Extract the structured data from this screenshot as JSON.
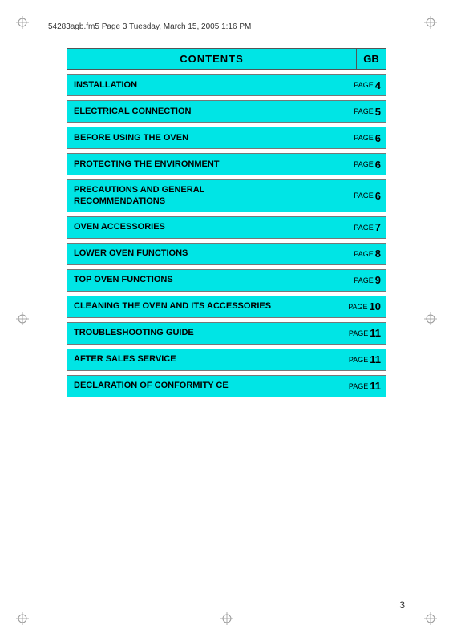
{
  "header": {
    "file_info": "54283agb.fm5  Page 3  Tuesday, March 15, 2005  1:16 PM"
  },
  "title": {
    "main_label": "CONTENTS",
    "gb_label": "GB"
  },
  "toc": {
    "items": [
      {
        "label": "INSTALLATION",
        "page_word": "PAGE",
        "page_num": "4"
      },
      {
        "label": "ELECTRICAL CONNECTION",
        "page_word": "PAGE",
        "page_num": "5"
      },
      {
        "label": "BEFORE USING THE OVEN",
        "page_word": "PAGE",
        "page_num": "6"
      },
      {
        "label": "PROTECTING THE ENVIRONMENT",
        "page_word": "PAGE",
        "page_num": "6"
      },
      {
        "label": "PRECAUTIONS AND GENERAL\nRECOMMENDATIONS",
        "page_word": "PAGE",
        "page_num": "6"
      },
      {
        "label": "OVEN ACCESSORIES",
        "page_word": "PAGE",
        "page_num": "7"
      },
      {
        "label": "LOWER OVEN FUNCTIONS",
        "page_word": "PAGE",
        "page_num": "8"
      },
      {
        "label": "TOP OVEN FUNCTIONS",
        "page_word": "PAGE",
        "page_num": "9"
      },
      {
        "label": "CLEANING THE OVEN AND ITS ACCESSORIES",
        "page_word": "PAGE",
        "page_num": "10"
      },
      {
        "label": "TROUBLESHOOTING GUIDE",
        "page_word": "PAGE",
        "page_num": "11"
      },
      {
        "label": "AFTER SALES SERVICE",
        "page_word": "PAGE",
        "page_num": "11"
      },
      {
        "label": "DECLARATION OF CONFORMITY CE",
        "page_word": "PAGE",
        "page_num": "11"
      }
    ]
  },
  "footer": {
    "page_number": "3"
  }
}
